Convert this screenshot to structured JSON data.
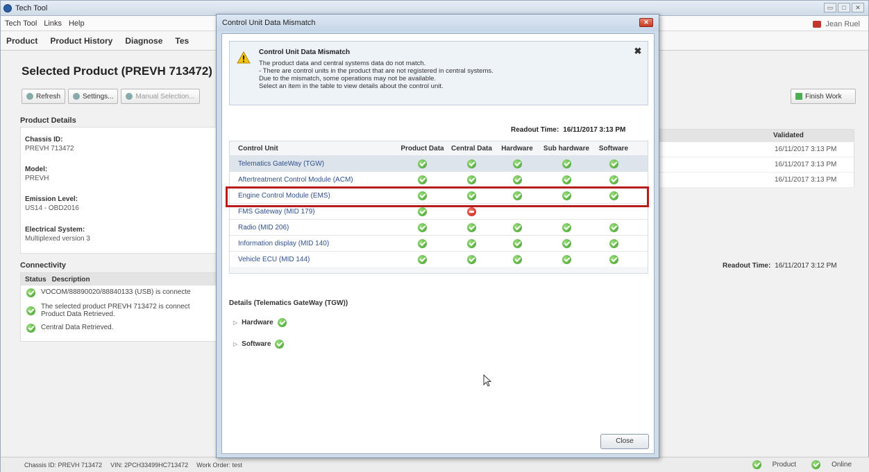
{
  "window": {
    "title": "Tech Tool"
  },
  "menu": [
    "Tech Tool",
    "Links",
    "Help"
  ],
  "user": "Jean Ruel",
  "tabs": [
    "Product",
    "Product History",
    "Diagnose",
    "Tes"
  ],
  "page_title": "Selected Product (PREVH 713472)",
  "toolbar": {
    "refresh": "Refresh",
    "settings": "Settings...",
    "manual": "Manual Selection...",
    "finish": "Finish Work"
  },
  "product_details": {
    "header": "Product Details",
    "fields": [
      {
        "label": "Chassis ID:",
        "value": "PREVH 713472"
      },
      {
        "label": "Model:",
        "value": "PREVH"
      },
      {
        "label": "Emission Level:",
        "value": "US14 - OBD2016"
      },
      {
        "label": "Electrical System:",
        "value": "Multiplexed version 3"
      }
    ]
  },
  "connectivity": {
    "header": "Connectivity",
    "col_status": "Status",
    "col_desc": "Description",
    "rows": [
      "VOCOM/88890020/88840133 (USB) is connecte",
      "The selected product PREVH 713472 is connect",
      "Product Data Retrieved.",
      "Central Data Retrieved."
    ]
  },
  "validated": {
    "header": "Validated",
    "values": [
      "16/11/2017 3:13 PM",
      "16/11/2017 3:13 PM",
      "16/11/2017 3:13 PM"
    ]
  },
  "main_readout": {
    "label": "Readout Time:",
    "value": "16/11/2017 3:12 PM"
  },
  "statusbar": {
    "chassis": "Chassis ID: PREVH 713472",
    "vin": "VIN: 2PCH33499HC713472",
    "work_order": "Work Order: test",
    "product": "Product",
    "online": "Online"
  },
  "dialog": {
    "title": "Control Unit Data Mismatch",
    "warn_title": "Control Unit Data Mismatch",
    "warn_lines": [
      "The product data and central systems data do not match.",
      " - There are control units in the product that are not registered in central systems.",
      "Due to the mismatch, some operations may not be available.",
      "Select an item in the table to view details about the control unit."
    ],
    "readout_label": "Readout Time:",
    "readout_value": "16/11/2017 3:13 PM",
    "columns": [
      "Control Unit",
      "Product Data",
      "Central Data",
      "Hardware",
      "Sub hardware",
      "Software"
    ],
    "rows": [
      {
        "name": "Telematics GateWay (TGW)",
        "cells": [
          "ok",
          "ok",
          "ok",
          "ok",
          "ok"
        ],
        "selected": true
      },
      {
        "name": "Aftertreatment Control Module (ACM)",
        "cells": [
          "ok",
          "ok",
          "ok",
          "ok",
          "ok"
        ]
      },
      {
        "name": "Engine Control Module (EMS)",
        "cells": [
          "ok",
          "ok",
          "ok",
          "ok",
          "ok"
        ]
      },
      {
        "name": "FMS Gateway (MID 179)",
        "cells": [
          "ok",
          "stop",
          "",
          "",
          ""
        ]
      },
      {
        "name": "Radio (MID 206)",
        "cells": [
          "ok",
          "ok",
          "ok",
          "ok",
          "ok"
        ]
      },
      {
        "name": "Information display (MID 140)",
        "cells": [
          "ok",
          "ok",
          "ok",
          "ok",
          "ok"
        ]
      },
      {
        "name": "Vehicle ECU (MID 144)",
        "cells": [
          "ok",
          "ok",
          "ok",
          "ok",
          "ok"
        ]
      }
    ],
    "details_title": "Details (Telematics GateWay (TGW))",
    "details": [
      "Hardware",
      "Software"
    ],
    "close_label": "Close"
  }
}
